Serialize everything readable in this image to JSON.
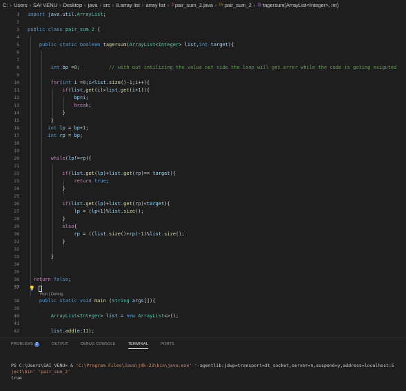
{
  "breadcrumb": {
    "drive": "C:",
    "items": [
      "Users",
      "SAI VENU",
      "Desktop",
      "java",
      "src",
      "8.array list",
      "array list"
    ],
    "file": "pair_sum_2.java",
    "class": "pair_sum_2",
    "method": "tagersum(ArrayList<Integer>, int)"
  },
  "lines": [
    {
      "n": "1",
      "c": "import java.util.ArrayList;"
    },
    {
      "n": "2",
      "c": ""
    },
    {
      "n": "3",
      "c": "public class pair_sum_2 {"
    },
    {
      "n": "4",
      "c": ""
    },
    {
      "n": "5",
      "c": "    public static boolean tagersum(ArrayList<Integer> list,int target){"
    },
    {
      "n": "6",
      "c": ""
    },
    {
      "n": "7",
      "c": ""
    },
    {
      "n": "8",
      "c": "        int bp =0;          // with out intilizing the value out side the loop will get error while the code is geting exiguted"
    },
    {
      "n": "9",
      "c": ""
    },
    {
      "n": "10",
      "c": "        for(int i =0;i<list.size()-1;i++){"
    },
    {
      "n": "11",
      "c": "            if(list.get(i)>list.get(i+1)){"
    },
    {
      "n": "12",
      "c": "                bp=i;"
    },
    {
      "n": "13",
      "c": "                break;"
    },
    {
      "n": "14",
      "c": "            }"
    },
    {
      "n": "15",
      "c": "        }"
    },
    {
      "n": "16",
      "c": "       int lp = bp+1;"
    },
    {
      "n": "17",
      "c": "       int rp = bp;"
    },
    {
      "n": "18",
      "c": ""
    },
    {
      "n": "19",
      "c": ""
    },
    {
      "n": "20",
      "c": "        while(lp!=rp){"
    },
    {
      "n": "21",
      "c": ""
    },
    {
      "n": "22",
      "c": "            if(list.get(lp)+list.get(rp)== target){"
    },
    {
      "n": "23",
      "c": "                return true;"
    },
    {
      "n": "24",
      "c": "            }"
    },
    {
      "n": "25",
      "c": ""
    },
    {
      "n": "26",
      "c": "            if(list.get(lp)+list.get(rp)<target){"
    },
    {
      "n": "27",
      "c": "                lp = (lp+1)%list.size();"
    },
    {
      "n": "28",
      "c": "            }"
    },
    {
      "n": "29",
      "c": "            else{"
    },
    {
      "n": "30",
      "c": "                rp = ((list.size()+rp)-1)%list.size();"
    },
    {
      "n": "31",
      "c": "            }"
    },
    {
      "n": "32",
      "c": ""
    },
    {
      "n": "33",
      "c": "        }"
    },
    {
      "n": "34",
      "c": ""
    },
    {
      "n": "35",
      "c": ""
    },
    {
      "n": "36",
      "c": "  return false;"
    },
    {
      "n": "37",
      "c": ""
    },
    {
      "n": "38",
      "c": "    public static void main (String args[]){"
    },
    {
      "n": "39",
      "c": ""
    },
    {
      "n": "40",
      "c": "        ArrayList<Integer> list = new ArrayList<>();"
    },
    {
      "n": "41",
      "c": ""
    },
    {
      "n": "42",
      "c": "        list.add(e:11);"
    }
  ],
  "codelens": "Run | Debug",
  "panel": {
    "tabs": [
      "PROBLEMS",
      "OUTPUT",
      "DEBUG CONSOLE",
      "TERMINAL",
      "PORTS"
    ],
    "active_tab": "TERMINAL",
    "problems_count": "2"
  },
  "terminal": {
    "prompt": "PS C:\\Users\\SAI VENU>",
    "amp": "&",
    "java_path": "'C:\\Program Files\\Java\\jdk-23\\bin\\java.exe'",
    "args": "'-agentlib:jdwp=transport=dt_socket,server=n,suspend=y,address=localhost:5",
    "line2_a": "ject\\bin'",
    "line2_b": "'pair_sum_2'",
    "output": "true"
  },
  "colors": {
    "background": "#1e1e1e",
    "keyword": "#569cd6",
    "type": "#4ec9b0",
    "function": "#dcdcaa",
    "variable": "#9cdcfe",
    "comment": "#6a9955",
    "control": "#c586c0",
    "badge": "#4d78cc"
  }
}
